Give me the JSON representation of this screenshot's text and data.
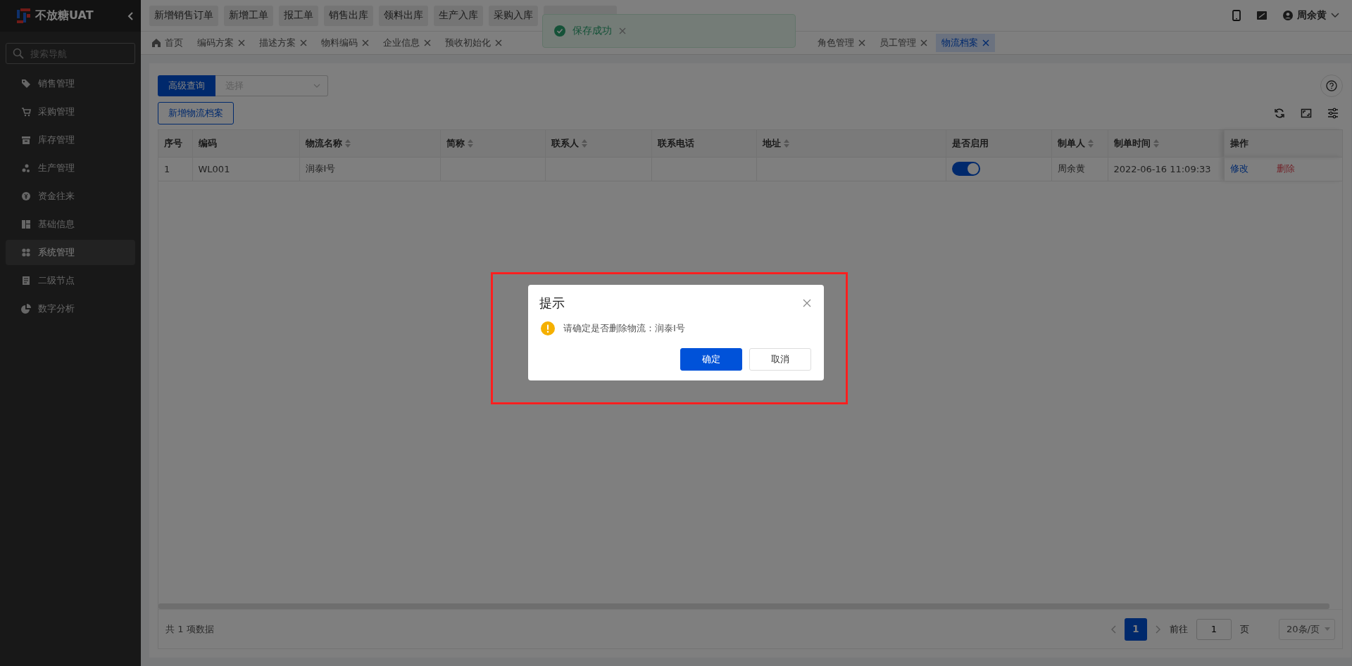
{
  "sidebar": {
    "logo_text": "不放糖UAT",
    "search_placeholder": "搜索导航",
    "items": [
      {
        "label": "销售管理",
        "selected": false
      },
      {
        "label": "采购管理",
        "selected": false
      },
      {
        "label": "库存管理",
        "selected": false
      },
      {
        "label": "生产管理",
        "selected": false
      },
      {
        "label": "资金往来",
        "selected": false
      },
      {
        "label": "基础信息",
        "selected": false
      },
      {
        "label": "系统管理",
        "selected": true
      },
      {
        "label": "二级节点",
        "selected": false
      },
      {
        "label": "数字分析",
        "selected": false
      }
    ]
  },
  "shortcuts": [
    {
      "label": "新增销售订单"
    },
    {
      "label": "新增工单"
    },
    {
      "label": "报工单"
    },
    {
      "label": "销售出库"
    },
    {
      "label": "领料出库"
    },
    {
      "label": "生产入库"
    },
    {
      "label": "采购入库"
    },
    {
      "kind": "covered"
    }
  ],
  "user": {
    "name": "周余黄"
  },
  "tabs": [
    {
      "label": "首页",
      "selected": false,
      "closable": false
    },
    {
      "label": "编码方案",
      "selected": false,
      "closable": true
    },
    {
      "label": "描述方案",
      "selected": false,
      "closable": true
    },
    {
      "label": "物料编码",
      "selected": false,
      "closable": true
    },
    {
      "label": "企业信息",
      "selected": false,
      "closable": true
    },
    {
      "label": "预收初始化",
      "selected": false,
      "closable": true
    },
    {
      "label": "角色管理",
      "selected": false,
      "closable": true
    },
    {
      "label": "员工管理",
      "selected": false,
      "closable": true
    },
    {
      "label": "物流档案",
      "selected": true,
      "closable": true
    }
  ],
  "toolbar": {
    "query_button": "高级查询",
    "select_placeholder": "选择",
    "add_button": "新增物流档案"
  },
  "table": {
    "columns": [
      {
        "label": "序号",
        "sortable": false,
        "kind": "text"
      },
      {
        "label": "编码",
        "sortable": false,
        "kind": "text"
      },
      {
        "label": "物流名称",
        "sortable": true,
        "kind": "text"
      },
      {
        "label": "简称",
        "sortable": true,
        "kind": "text"
      },
      {
        "label": "联系人",
        "sortable": true,
        "kind": "text"
      },
      {
        "label": "联系电话",
        "sortable": false,
        "kind": "text"
      },
      {
        "label": "地址",
        "sortable": true,
        "kind": "text"
      },
      {
        "label": "是否启用",
        "sortable": false,
        "kind": "switch"
      },
      {
        "label": "制单人",
        "sortable": true,
        "kind": "text"
      },
      {
        "label": "制单时间",
        "sortable": true,
        "kind": "text"
      }
    ],
    "actions_label": "操作",
    "rows": [
      {
        "cells": [
          "1",
          "WL001",
          "润泰I号",
          null,
          null,
          null,
          null,
          true,
          "周余黄",
          "2022-06-16 11:09:33"
        ],
        "actions": [
          {
            "label": "修改",
            "kind": "edit"
          },
          {
            "label": "删除",
            "kind": "delete"
          }
        ]
      }
    ]
  },
  "pagination": {
    "total": "共 1 项数据",
    "pages": [
      {
        "label": "1",
        "selected": true
      }
    ],
    "goto_label": "前往",
    "goto_value": "1",
    "goto_suffix": "页",
    "page_size": "20条/页"
  },
  "toast": {
    "message": "保存成功"
  },
  "dialog": {
    "title": "提示",
    "message": "请确定是否删除物流：润泰I号",
    "buttons": [
      {
        "label": "确定",
        "kind": "primary"
      },
      {
        "label": "取消",
        "kind": "default"
      }
    ]
  }
}
